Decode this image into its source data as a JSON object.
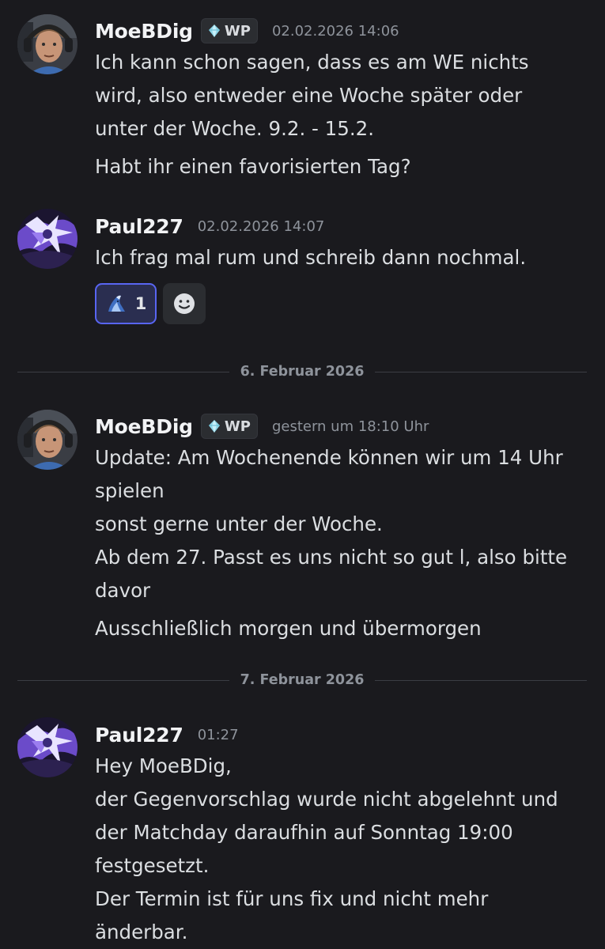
{
  "messages": [
    {
      "author": "MoeBDig",
      "tag": "WP",
      "timestamp": "02.02.2026 14:06",
      "lines": [
        "Ich kann schon sagen, dass es am WE nichts",
        "wird, also entweder eine Woche später oder",
        "unter der Woche. 9.2. - 15.2."
      ],
      "lines2": [
        "Habt ihr einen favorisierten Tag?"
      ]
    },
    {
      "author": "Paul227",
      "timestamp": "02.02.2026 14:07",
      "lines": [
        "Ich frag mal rum und schreib dann nochmal."
      ],
      "reactions": [
        {
          "emoji": "shark-emoji",
          "count": "1"
        }
      ]
    },
    {
      "author": "MoeBDig",
      "tag": "WP",
      "timestamp": "gestern um 18:10 Uhr",
      "lines": [
        "Update: Am Wochenende können wir um 14 Uhr",
        "spielen",
        "sonst gerne unter der Woche.",
        "Ab dem 27. Passt es uns nicht so gut l, also bitte",
        "davor"
      ],
      "lines2": [
        "Ausschließlich morgen und übermorgen"
      ]
    },
    {
      "author": "Paul227",
      "timestamp": "01:27",
      "lines": [
        "Hey MoeBDig,",
        "der Gegenvorschlag wurde nicht abgelehnt und",
        "der Matchday daraufhin auf Sonntag 19:00",
        "festgesetzt.",
        "Der Termin ist für uns fix und nicht mehr",
        "änderbar."
      ]
    }
  ],
  "dividers": [
    "6. Februar 2026",
    "7. Februar 2026"
  ],
  "colors": {
    "background": "#1a1a1e",
    "text": "#dbdee1",
    "username": "#f2f3f5",
    "muted": "#8e939b",
    "reaction_border": "#5865f2",
    "reaction_bg": "#2a2e50"
  }
}
